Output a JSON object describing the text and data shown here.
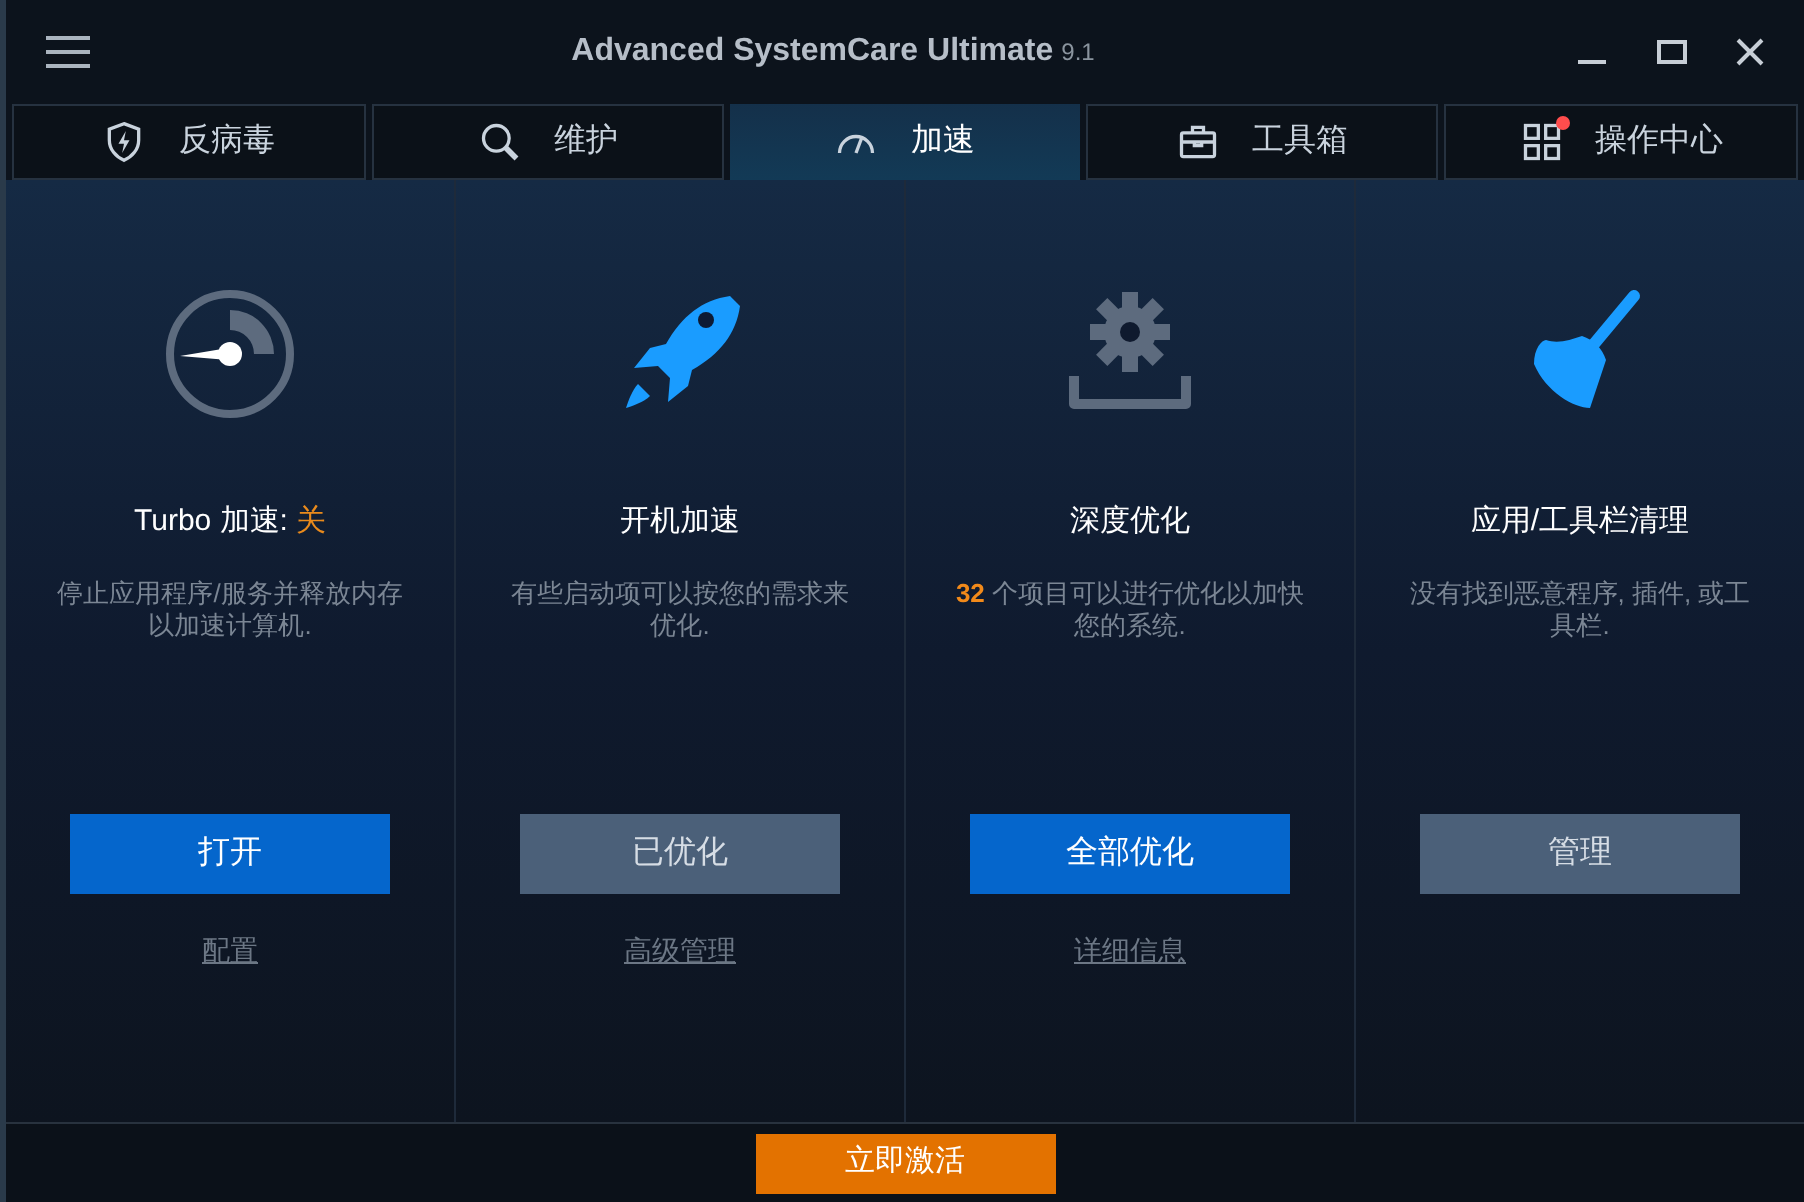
{
  "window": {
    "title": "Advanced SystemCare Ultimate",
    "version": "9.1"
  },
  "tabs": [
    {
      "label": "反病毒",
      "selected": false,
      "notification": false
    },
    {
      "label": "维护",
      "selected": false,
      "notification": false
    },
    {
      "label": "加速",
      "selected": true,
      "notification": false
    },
    {
      "label": "工具箱",
      "selected": false,
      "notification": false
    },
    {
      "label": "操作中心",
      "selected": false,
      "notification": true
    }
  ],
  "cards": [
    {
      "title": "Turbo 加速:",
      "status": "关",
      "description": "停止应用程序/服务并释放内存以加速计算机.",
      "button": {
        "label": "打开",
        "kind": "primary"
      },
      "link": "配置"
    },
    {
      "title": "开机加速",
      "description": "有些启动项可以按您的需求来优化.",
      "button": {
        "label": "已优化",
        "kind": "secondary"
      },
      "link": "高级管理"
    },
    {
      "title": "深度优化",
      "count": "32",
      "description": "个项目可以进行优化以加快您的系统.",
      "button": {
        "label": "全部优化",
        "kind": "primary"
      },
      "link": "详细信息"
    },
    {
      "title": "应用/工具栏清理",
      "description": "没有找到恶意程序, 插件, 或工具栏.",
      "button": {
        "label": "管理",
        "kind": "secondary"
      }
    }
  ],
  "footer": {
    "button": "立即激活"
  }
}
